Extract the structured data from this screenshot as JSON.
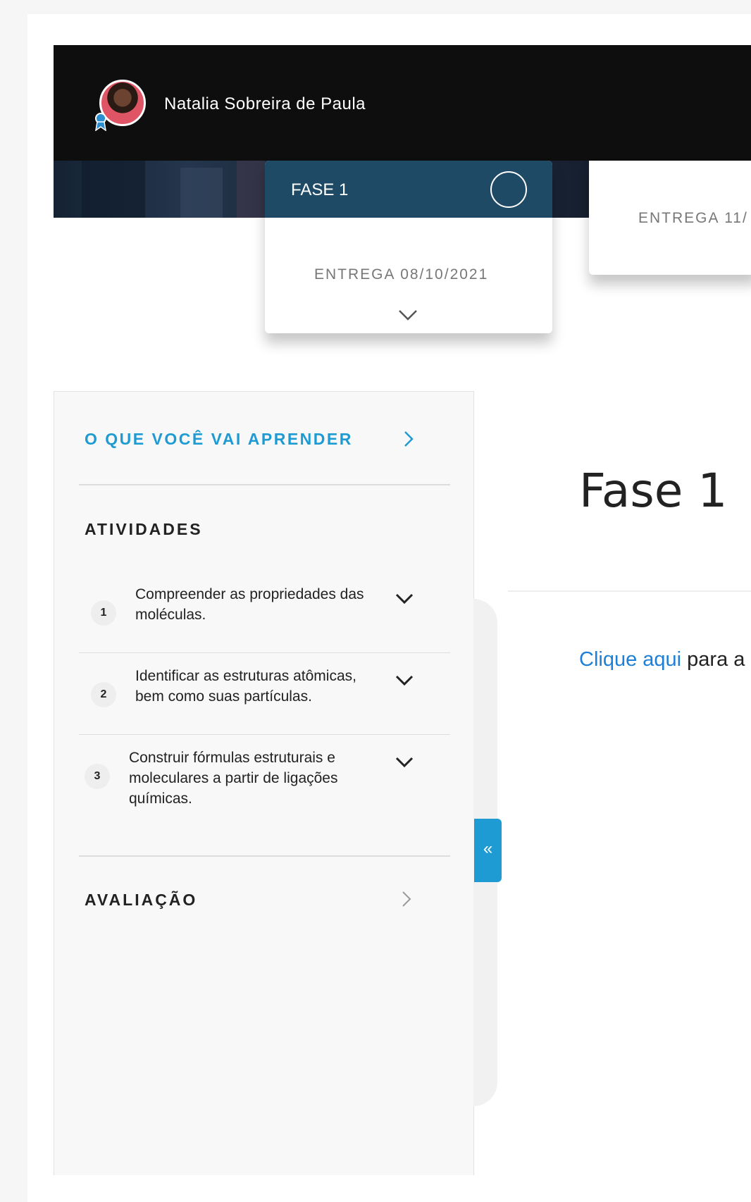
{
  "header": {
    "user_name": "Natalia Sobreira de Paula"
  },
  "phases": [
    {
      "label": "FASE 1",
      "delivery": "ENTREGA 08/10/2021"
    },
    {
      "label": "",
      "delivery": "ENTREGA 11/"
    }
  ],
  "sidebar": {
    "learn_label": "O QUE VOCÊ VAI APRENDER",
    "activities_title": "ATIVIDADES",
    "activities": [
      {
        "number": "1",
        "text": "Compreender as propriedades das moléculas."
      },
      {
        "number": "2",
        "text": "Identificar as estruturas atômicas, bem como suas partículas."
      },
      {
        "number": "3",
        "text": "Construir fórmulas estruturais e moleculares a partir de ligações químicas."
      }
    ],
    "evaluation_label": "AVALIAÇÃO",
    "collapse_symbol": "«"
  },
  "main": {
    "title": "Fase 1",
    "link_text": "Clique aqui",
    "after_link_text": " para a"
  },
  "colors": {
    "topbar": "#0e0e0e",
    "phase_header": "#1e4a66",
    "accent": "#1e9bd2",
    "link": "#1e7fd6"
  },
  "icons": {
    "phase_status": "circle-outline-icon",
    "expand": "chevron-down-icon",
    "navigate": "chevron-right-icon",
    "collapse": "double-chevron-left-icon",
    "badge": "award-ribbon-icon"
  }
}
